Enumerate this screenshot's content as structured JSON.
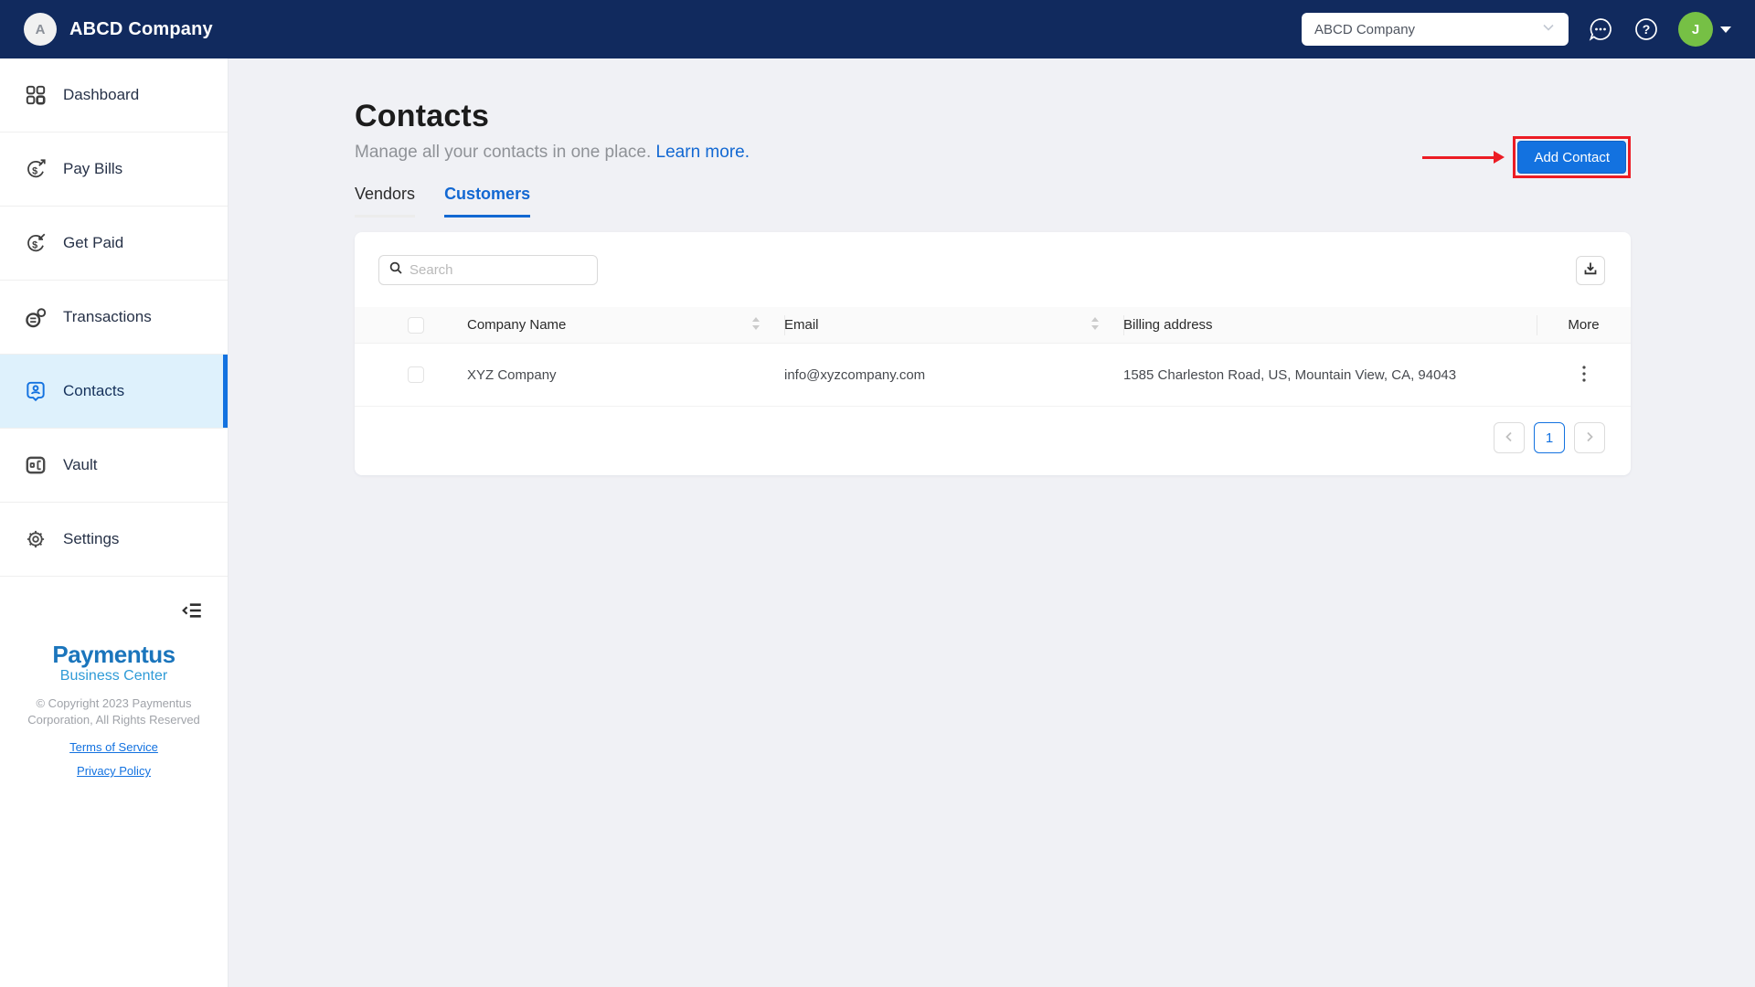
{
  "header": {
    "logo_initial": "A",
    "company_name": "ABCD Company",
    "account_selector": {
      "value": "ABCD Company"
    },
    "user_avatar_initial": "J"
  },
  "sidebar": {
    "items": [
      {
        "label": "Dashboard"
      },
      {
        "label": "Pay Bills"
      },
      {
        "label": "Get Paid"
      },
      {
        "label": "Transactions"
      },
      {
        "label": "Contacts"
      },
      {
        "label": "Vault"
      },
      {
        "label": "Settings"
      }
    ],
    "active_item": "Contacts",
    "footer": {
      "brand": "Paymentus",
      "brand_sub": "Business Center",
      "copyright_line1": "© Copyright 2023 Paymentus",
      "copyright_line2": "Corporation, All Rights Reserved",
      "terms_link": "Terms of Service",
      "privacy_link": "Privacy Policy"
    }
  },
  "page": {
    "title": "Contacts",
    "subtitle": "Manage all your contacts in one place.",
    "learn_more_link": "Learn more.",
    "add_contact_button": "Add Contact",
    "tabs": [
      {
        "label": "Vendors",
        "active": false
      },
      {
        "label": "Customers",
        "active": true
      }
    ]
  },
  "contacts_table": {
    "search_placeholder": "Search",
    "columns": {
      "company": "Company Name",
      "email": "Email",
      "billing": "Billing address",
      "more": "More"
    },
    "rows": [
      {
        "company_name": "XYZ Company",
        "email": "info@xyzcompany.com",
        "billing_address": "1585 Charleston Road, US, Mountain View, CA, 94043"
      }
    ],
    "pagination": {
      "current_page": "1"
    }
  },
  "colors": {
    "accent_blue": "#1372e0",
    "header_navy": "#112a5e",
    "active_item_bg": "#def1fc",
    "annotation_red": "#ec1c24",
    "brand_blue": "#1b75bc",
    "brand_light_blue": "#2f9bd7",
    "avatar_green": "#76c045",
    "page_bg": "#f0f1f5"
  }
}
